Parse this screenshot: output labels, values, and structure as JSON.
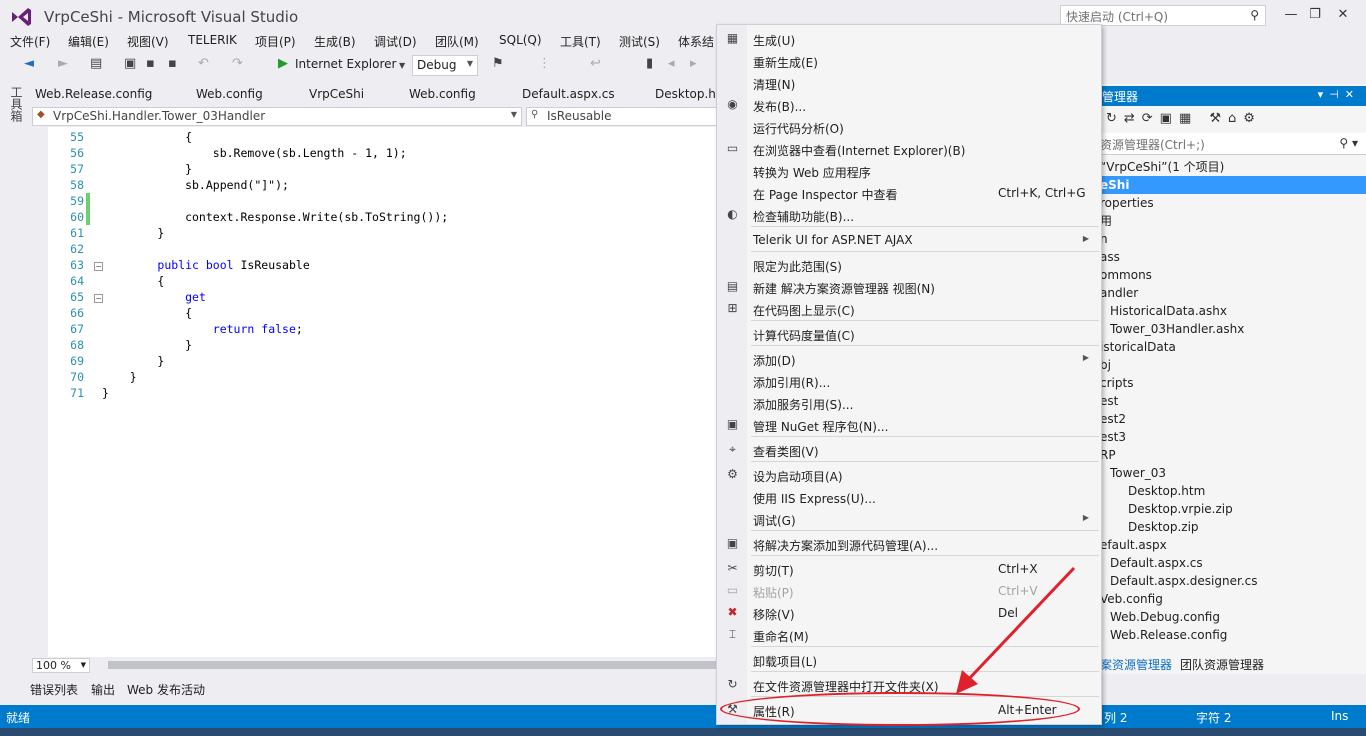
{
  "window": {
    "title": "VrpCeShi - Microsoft Visual Studio",
    "quick_launch": "快速启动 (Ctrl+Q)"
  },
  "menu": [
    "文件(F)",
    "编辑(E)",
    "视图(V)",
    "TELERIK",
    "项目(P)",
    "生成(B)",
    "调试(D)",
    "团队(M)",
    "SQL(Q)",
    "工具(T)",
    "测试(S)",
    "体系结"
  ],
  "toolbar": {
    "browser": "Internet Explorer",
    "config": "Debug"
  },
  "toolbox_label": "工具箱",
  "tabs": [
    "Web.Release.config",
    "Web.config",
    "VrpCeShi",
    "Web.config",
    "Default.aspx.cs",
    "Desktop.ht"
  ],
  "nav": {
    "type": "VrpCeShi.Handler.Tower_03Handler",
    "member": "IsReusable"
  },
  "code": {
    "line_numbers": [
      "55",
      "56",
      "57",
      "58",
      "59",
      "60",
      "61",
      "62",
      "63",
      "64",
      "65",
      "66",
      "67",
      "68",
      "69",
      "70",
      "71"
    ],
    "lines": [
      "            {",
      "                sb.Remove(sb.Length - 1, 1);",
      "            }",
      "            sb.Append(\"]\");",
      "",
      "            context.Response.Write(sb.ToString());",
      "        }",
      "",
      "        public bool IsReusable",
      "        {",
      "            get",
      "            {",
      "                return false;",
      "            }",
      "        }",
      "    }",
      "}"
    ]
  },
  "zoom": "100 %",
  "bottom_tabs": [
    "错误列表",
    "输出",
    "Web 发布活动"
  ],
  "solution_explorer": {
    "title": "管理器",
    "search": "资源管理器(Ctrl+;)",
    "items": [
      "“VrpCeShi”(1 个项目)",
      "eShi",
      "roperties",
      "用",
      "n",
      "ass",
      "ommons",
      "andler",
      "HistoricalData.ashx",
      "Tower_03Handler.ashx",
      "istoricalData",
      "bj",
      "cripts",
      "est",
      "est2",
      "est3",
      "RP",
      "Tower_03",
      "Desktop.htm",
      "Desktop.vrpie.zip",
      "Desktop.zip",
      "efault.aspx",
      "Default.aspx.cs",
      "Default.aspx.designer.cs",
      "Veb.config",
      "Web.Debug.config",
      "Web.Release.config"
    ],
    "tab1": "案资源管理器",
    "tab2": "团队资源管理器"
  },
  "status": {
    "ready": "就绪",
    "col": "列 2",
    "ch": "字符 2",
    "mode": "Ins"
  },
  "context_menu": [
    {
      "label": "生成(U)",
      "icon": "build-icon"
    },
    {
      "label": "重新生成(E)"
    },
    {
      "label": "清理(N)"
    },
    {
      "label": "发布(B)...",
      "icon": "publish-icon"
    },
    {
      "label": "运行代码分析(O)"
    },
    {
      "label": "在浏览器中查看(Internet Explorer)(B)",
      "icon": "browser-icon"
    },
    {
      "label": "转换为 Web 应用程序"
    },
    {
      "label": "在 Page Inspector 中查看",
      "shortcut": "Ctrl+K, Ctrl+G"
    },
    {
      "label": "检查辅助功能(B)...",
      "icon": "accessibility-icon"
    },
    {
      "label": "Telerik UI for ASP.NET AJAX",
      "submenu": true
    },
    {
      "label": "限定为此范围(S)"
    },
    {
      "label": "新建 解决方案资源管理器 视图(N)",
      "icon": "new-view-icon"
    },
    {
      "label": "在代码图上显示(C)",
      "icon": "code-map-icon"
    },
    {
      "label": "计算代码度量值(C)"
    },
    {
      "label": "添加(D)",
      "submenu": true
    },
    {
      "label": "添加引用(R)..."
    },
    {
      "label": "添加服务引用(S)..."
    },
    {
      "label": "管理 NuGet 程序包(N)...",
      "icon": "nuget-icon"
    },
    {
      "label": "查看类图(V)",
      "icon": "class-diagram-icon"
    },
    {
      "label": "设为启动项目(A)",
      "icon": "gear-icon"
    },
    {
      "label": "使用 IIS Express(U)..."
    },
    {
      "label": "调试(G)",
      "submenu": true
    },
    {
      "label": "将解决方案添加到源代码管理(A)...",
      "icon": "source-control-icon"
    },
    {
      "label": "剪切(T)",
      "shortcut": "Ctrl+X",
      "icon": "cut-icon"
    },
    {
      "label": "粘贴(P)",
      "shortcut": "Ctrl+V",
      "icon": "paste-icon",
      "disabled": true
    },
    {
      "label": "移除(V)",
      "shortcut": "Del",
      "icon": "remove-icon"
    },
    {
      "label": "重命名(M)",
      "icon": "rename-icon"
    },
    {
      "label": "卸载项目(L)"
    },
    {
      "label": "在文件资源管理器中打开文件夹(X)",
      "icon": "refresh-icon"
    },
    {
      "label": "属性(R)",
      "shortcut": "Alt+Enter",
      "icon": "wrench-icon"
    }
  ]
}
